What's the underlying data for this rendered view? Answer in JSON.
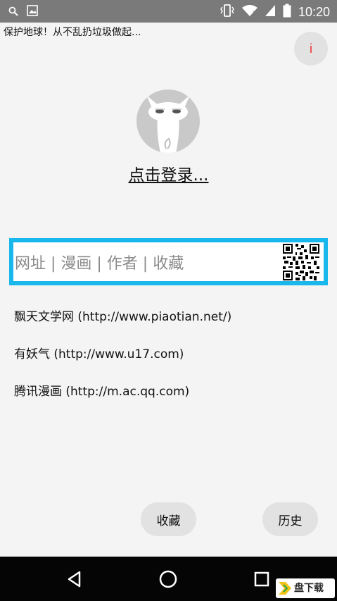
{
  "status_bar": {
    "time": "10:20"
  },
  "banner": {
    "text": "保护地球！从不乱扔垃圾做起..."
  },
  "info_button": {
    "label": "i"
  },
  "login": {
    "label": "点击登录..."
  },
  "search": {
    "placeholder": "网址 | 漫画 | 作者 | 收藏"
  },
  "sites": [
    {
      "label": "飘天文学网 (http://www.piaotian.net/)"
    },
    {
      "label": "有妖气 (http://www.u17.com)"
    },
    {
      "label": "腾讯漫画 (http://m.ac.qq.com)"
    }
  ],
  "buttons": {
    "favorites": "收藏",
    "history": "历史"
  },
  "watermark": {
    "title": "盘下载"
  },
  "colors": {
    "accent": "#19b8ec",
    "info": "#e33333",
    "status_bar": "#7a7a7a",
    "nav_bar": "#050505"
  }
}
